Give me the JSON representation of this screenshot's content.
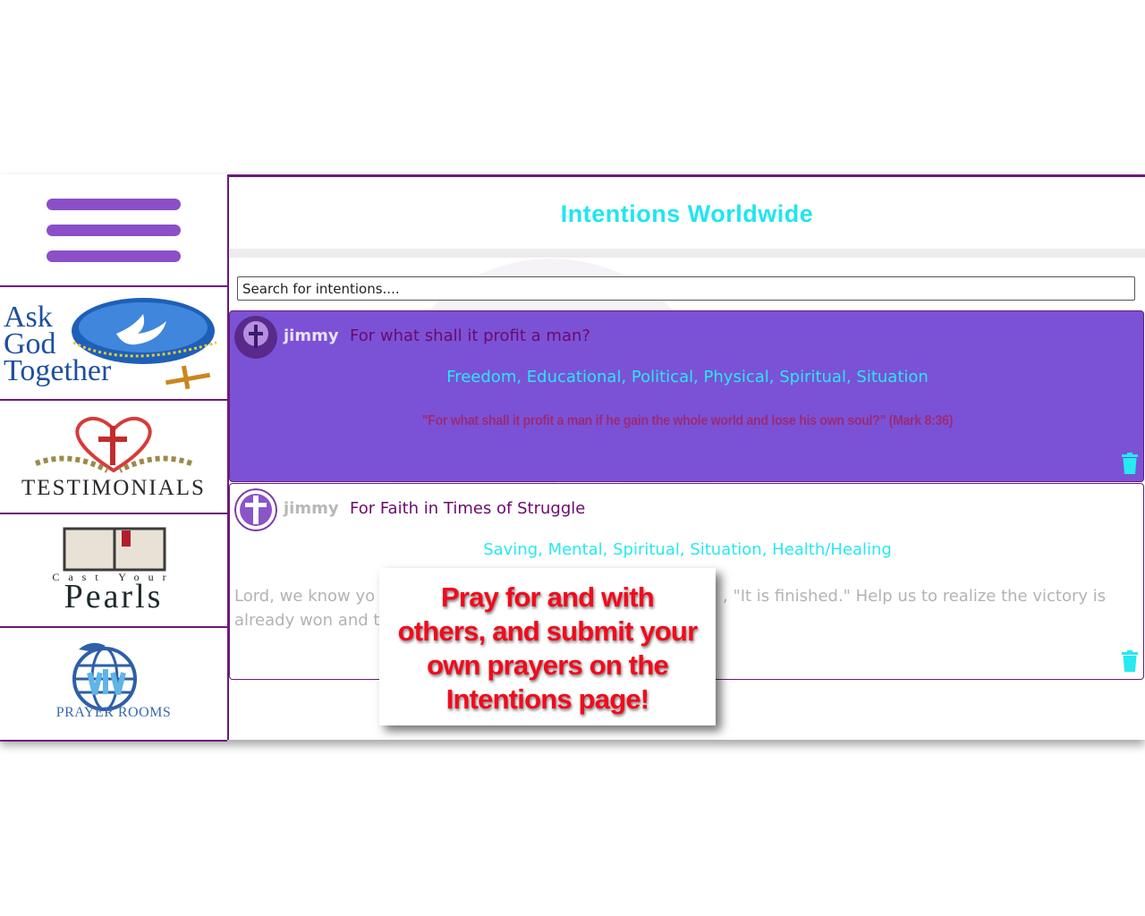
{
  "colors": {
    "accent_purple": "#6b1a7a",
    "menu_bar": "#8b4fc7",
    "card_highlight": "#7b52d6",
    "cyan": "#27e9f0",
    "callout_red": "#f20a1c"
  },
  "sidebar": {
    "menu_icon": "hamburger-menu-icon",
    "items": [
      {
        "name": "ask-god-together",
        "logo_text": [
          "Ask",
          "God",
          "Together"
        ]
      },
      {
        "name": "testimonials",
        "logo_text": "TESTIMONIALS"
      },
      {
        "name": "cast-your-pearls",
        "logo_text_top": "Cast Your",
        "logo_text_main": "Pearls"
      },
      {
        "name": "prayer-rooms",
        "logo_text": "PRAYER ROOMS"
      }
    ]
  },
  "main": {
    "title": "Intentions Worldwide",
    "search": {
      "placeholder": "Search for intentions....",
      "value": ""
    },
    "intentions": [
      {
        "user": "jimmy",
        "title": "For what shall it profit a man?",
        "categories": "Freedom, Educational, Political, Physical, Spiritual, Situation",
        "verse": "\"For what shall it profit a man if he gain the whole world and lose his own soul?\" (Mark 8:36)",
        "delete_icon": "trash-icon"
      },
      {
        "user": "jimmy",
        "title": "For Faith in Times of Struggle",
        "categories": "Saving, Mental, Spiritual, Situation, Health/Healing",
        "text_line1_left": "Lord, we know yo",
        "text_line1_right": ", \"It is finished.\" Help us to realize the victory is",
        "text_line2_left": "already won and t",
        "delete_icon": "trash-icon"
      }
    ]
  },
  "callout": {
    "lines": [
      "Pray for and with",
      "others, and submit your",
      "own prayers on the",
      "Intentions page!"
    ]
  }
}
